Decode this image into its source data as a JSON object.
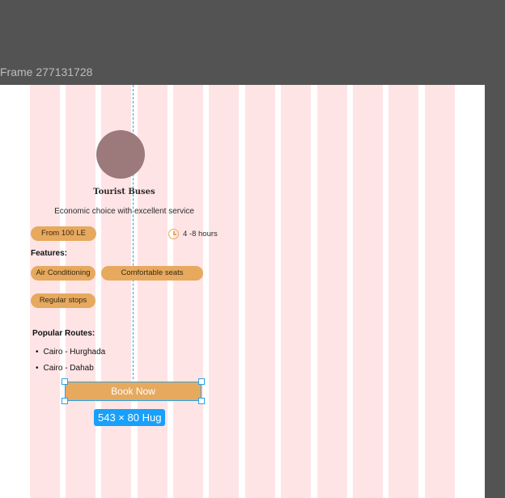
{
  "canvas": {
    "frame_name": "Frame 277131728"
  },
  "card": {
    "title": "Tourist Buses",
    "subtitle": "Economic choice with excellent service",
    "price_pill": "From 100 LE",
    "duration": "4 -8 hours",
    "features_label": "Features:",
    "features": [
      "Air Conditioning",
      "Comfortable seats",
      "Regular stops"
    ],
    "routes_title": "Popular Routes:",
    "routes": [
      "Cairo - Hurghada",
      "Cairo - Dahab"
    ],
    "book_button": "Book Now"
  },
  "selection": {
    "dimensions_label": "543 × 80 Hug"
  },
  "colors": {
    "canvas_bg": "#535353",
    "layout_grid_column": "#ffe4e6",
    "pill_accent": "#e6a95e",
    "selection_blue": "#18a0fb",
    "avatar": "#9c7a7b"
  },
  "icons": {
    "duration": "clock-icon"
  }
}
